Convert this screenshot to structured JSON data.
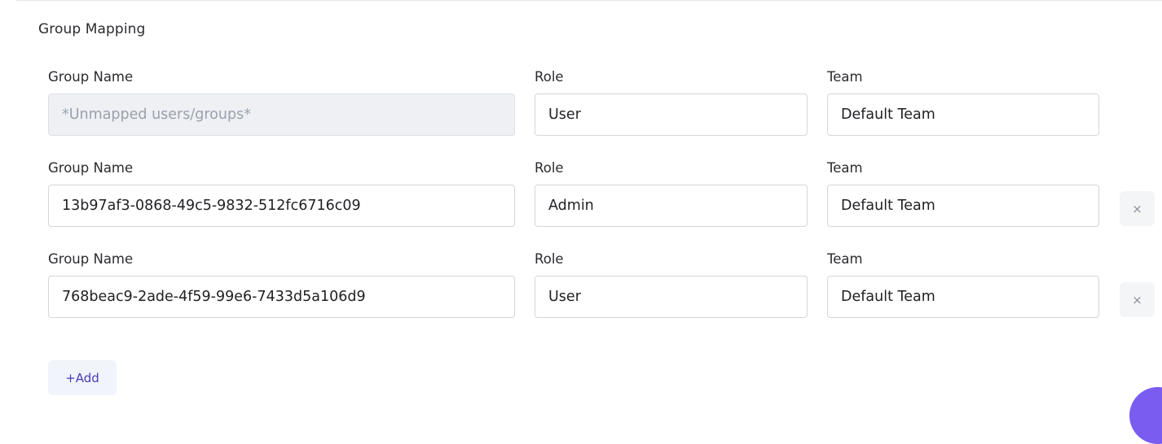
{
  "section": {
    "title": "Group Mapping"
  },
  "labels": {
    "group_name": "Group Name",
    "role": "Role",
    "team": "Team"
  },
  "rows": [
    {
      "group_name": "",
      "group_placeholder": "*Unmapped users/groups*",
      "role": "User",
      "team": "Default Team",
      "removable": false,
      "disabled": true
    },
    {
      "group_name": "13b97af3-0868-49c5-9832-512fc6716c09",
      "role": "Admin",
      "team": "Default Team",
      "removable": true,
      "remove_icon": "×"
    },
    {
      "group_name": "768beac9-2ade-4f59-99e6-7433d5a106d9",
      "role": "User",
      "team": "Default Team",
      "removable": true,
      "remove_icon": "×"
    }
  ],
  "add_button": {
    "label": "+Add"
  },
  "colors": {
    "accent": "#4b3bb5",
    "fab": "#7b5cf0"
  }
}
